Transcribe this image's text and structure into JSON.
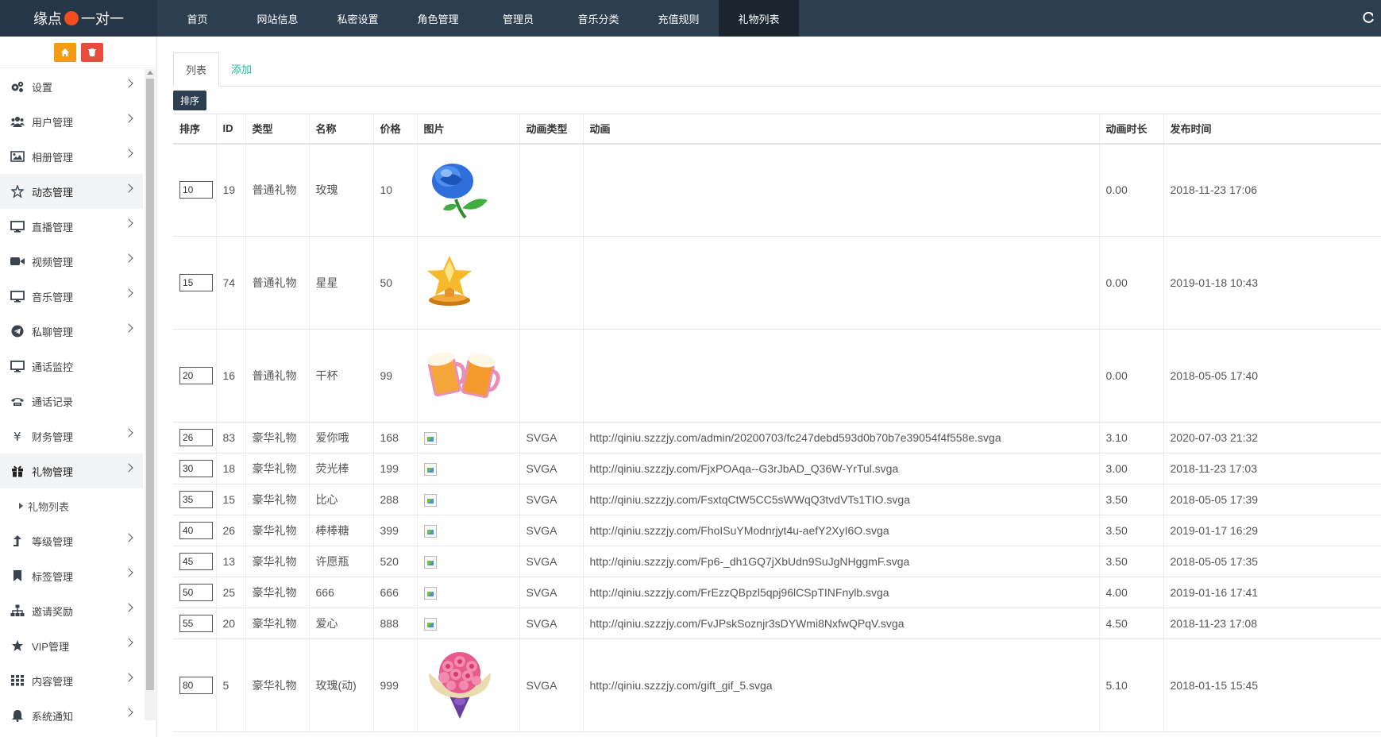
{
  "logo": {
    "left": "缘点",
    "right": "一对一"
  },
  "nav": [
    "首页",
    "网站信息",
    "私密设置",
    "角色管理",
    "管理员",
    "音乐分类",
    "充值规则",
    "礼物列表"
  ],
  "nav_active_index": 7,
  "sidebar": {
    "tools": {
      "home_icon": "home-icon",
      "delete_icon": "trash-icon"
    },
    "items": [
      {
        "label": "设置",
        "icon": "gears-icon",
        "chevron": true
      },
      {
        "label": "用户管理",
        "icon": "users-icon",
        "chevron": true
      },
      {
        "label": "相册管理",
        "icon": "picture-icon",
        "chevron": true
      },
      {
        "label": "动态管理",
        "icon": "star-outline-icon",
        "chevron": true,
        "active": true
      },
      {
        "label": "直播管理",
        "icon": "monitor-icon",
        "chevron": true
      },
      {
        "label": "视频管理",
        "icon": "video-icon",
        "chevron": true
      },
      {
        "label": "音乐管理",
        "icon": "monitor-icon",
        "chevron": true
      },
      {
        "label": "私聊管理",
        "icon": "telegram-icon",
        "chevron": true
      },
      {
        "label": "通话监控",
        "icon": "monitor-icon",
        "chevron": false
      },
      {
        "label": "通话记录",
        "icon": "phone-icon",
        "chevron": false
      },
      {
        "label": "财务管理",
        "icon": "yen-icon",
        "chevron": true
      },
      {
        "label": "礼物管理",
        "icon": "gift-icon",
        "chevron": true,
        "active": true
      },
      {
        "label": "礼物列表",
        "sub": true
      },
      {
        "label": "等级管理",
        "icon": "level-up-icon",
        "chevron": true
      },
      {
        "label": "标签管理",
        "icon": "bookmark-icon",
        "chevron": true
      },
      {
        "label": "邀请奖励",
        "icon": "sitemap-icon",
        "chevron": true
      },
      {
        "label": "VIP管理",
        "icon": "star-icon",
        "chevron": true
      },
      {
        "label": "内容管理",
        "icon": "grid-icon",
        "chevron": true
      },
      {
        "label": "系统通知",
        "icon": "bell-icon",
        "chevron": true
      }
    ]
  },
  "tabs": {
    "list": "列表",
    "add": "添加"
  },
  "sort_button": "排序",
  "table": {
    "headers": [
      "排序",
      "ID",
      "类型",
      "名称",
      "价格",
      "图片",
      "动画类型",
      "动画",
      "动画时长",
      "发布时间"
    ],
    "rows": [
      {
        "sort": "10",
        "id": "19",
        "type": "普通礼物",
        "name": "玫瑰",
        "price": "10",
        "image": "blue-rose",
        "anim_type": "",
        "anim": "",
        "duration": "0.00",
        "time": "2018-11-23 17:06"
      },
      {
        "sort": "15",
        "id": "74",
        "type": "普通礼物",
        "name": "星星",
        "price": "50",
        "image": "gold-star-trophy",
        "anim_type": "",
        "anim": "",
        "duration": "0.00",
        "time": "2019-01-18 10:43"
      },
      {
        "sort": "20",
        "id": "16",
        "type": "普通礼物",
        "name": "干杯",
        "price": "99",
        "image": "beer-mugs",
        "anim_type": "",
        "anim": "",
        "duration": "0.00",
        "time": "2018-05-05 17:40"
      },
      {
        "sort": "26",
        "id": "83",
        "type": "豪华礼物",
        "name": "爱你哦",
        "price": "168",
        "image": "broken",
        "anim_type": "SVGA",
        "anim": "http://qiniu.szzzjy.com/admin/20200703/fc247debd593d0b70b7e39054f4f558e.svga",
        "duration": "3.10",
        "time": "2020-07-03 21:32"
      },
      {
        "sort": "30",
        "id": "18",
        "type": "豪华礼物",
        "name": "荧光棒",
        "price": "199",
        "image": "broken",
        "anim_type": "SVGA",
        "anim": "http://qiniu.szzzjy.com/FjxPOAqa--G3rJbAD_Q36W-YrTul.svga",
        "duration": "3.00",
        "time": "2018-11-23 17:03"
      },
      {
        "sort": "35",
        "id": "15",
        "type": "豪华礼物",
        "name": "比心",
        "price": "288",
        "image": "broken",
        "anim_type": "SVGA",
        "anim": "http://qiniu.szzzjy.com/FsxtqCtW5CC5sWWqQ3tvdVTs1TIO.svga",
        "duration": "3.50",
        "time": "2018-05-05 17:39"
      },
      {
        "sort": "40",
        "id": "26",
        "type": "豪华礼物",
        "name": "棒棒糖",
        "price": "399",
        "image": "broken",
        "anim_type": "SVGA",
        "anim": "http://qiniu.szzzjy.com/FhoISuYModnrjyt4u-aefY2XyI6O.svga",
        "duration": "3.50",
        "time": "2019-01-17 16:29"
      },
      {
        "sort": "45",
        "id": "13",
        "type": "豪华礼物",
        "name": "许愿瓶",
        "price": "520",
        "image": "broken",
        "anim_type": "SVGA",
        "anim": "http://qiniu.szzzjy.com/Fp6-_dh1GQ7jXbUdn9SuJgNHggmF.svga",
        "duration": "3.50",
        "time": "2018-05-05 17:35"
      },
      {
        "sort": "50",
        "id": "25",
        "type": "豪华礼物",
        "name": "666",
        "price": "666",
        "image": "broken",
        "anim_type": "SVGA",
        "anim": "http://qiniu.szzzjy.com/FrEzzQBpzl5qpj96lCSpTINFnylb.svga",
        "duration": "4.00",
        "time": "2019-01-16 17:41"
      },
      {
        "sort": "55",
        "id": "20",
        "type": "豪华礼物",
        "name": "爱心",
        "price": "888",
        "image": "broken",
        "anim_type": "SVGA",
        "anim": "http://qiniu.szzzjy.com/FvJPskSoznjr3sDYWmi8NxfwQPqV.svga",
        "duration": "4.50",
        "time": "2018-11-23 17:08"
      },
      {
        "sort": "80",
        "id": "5",
        "type": "豪华礼物",
        "name": "玫瑰(动)",
        "price": "999",
        "image": "rose-bouquet",
        "anim_type": "SVGA",
        "anim": "http://qiniu.szzzjy.com/gift_gif_5.svga",
        "duration": "5.10",
        "time": "2018-01-15 15:45"
      }
    ]
  }
}
